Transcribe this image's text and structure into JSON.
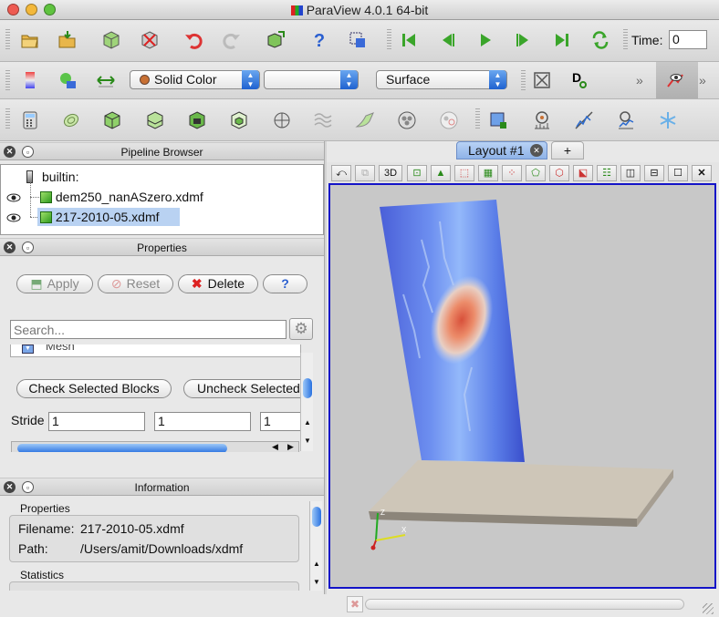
{
  "window": {
    "title": "ParaView 4.0.1 64-bit"
  },
  "toolbar": {
    "time_label": "Time:",
    "time_value": "0"
  },
  "toolbar2": {
    "color_combo": "Solid Color",
    "component_combo": "",
    "representation_combo": "Surface"
  },
  "pipeline": {
    "header": "Pipeline Browser",
    "items": [
      {
        "label": "builtin:"
      },
      {
        "label": "dem250_nanASzero.xdmf"
      },
      {
        "label": "217-2010-05.xdmf"
      }
    ]
  },
  "properties": {
    "header": "Properties",
    "apply": "Apply",
    "reset": "Reset",
    "delete": "Delete",
    "help": "?",
    "search_placeholder": "Search...",
    "mesh_label": "Mesh",
    "check_blocks": "Check Selected Blocks",
    "uncheck_blocks": "Uncheck Selected",
    "stride_label": "Stride",
    "stride_values": [
      "1",
      "1",
      "1"
    ]
  },
  "information": {
    "header": "Information",
    "section_properties": "Properties",
    "filename_label": "Filename:",
    "filename_value": "217-2010-05.xdmf",
    "path_label": "Path:",
    "path_value": "/Users/amit/Downloads/xdmf",
    "section_statistics": "Statistics"
  },
  "layout": {
    "tab_label": "Layout #1",
    "add_tab": "+",
    "view_3d": "3D"
  },
  "colors": {
    "selection": "#b9d2f2",
    "view_border": "#1414c8",
    "view_bg": "#c8c8c8"
  }
}
